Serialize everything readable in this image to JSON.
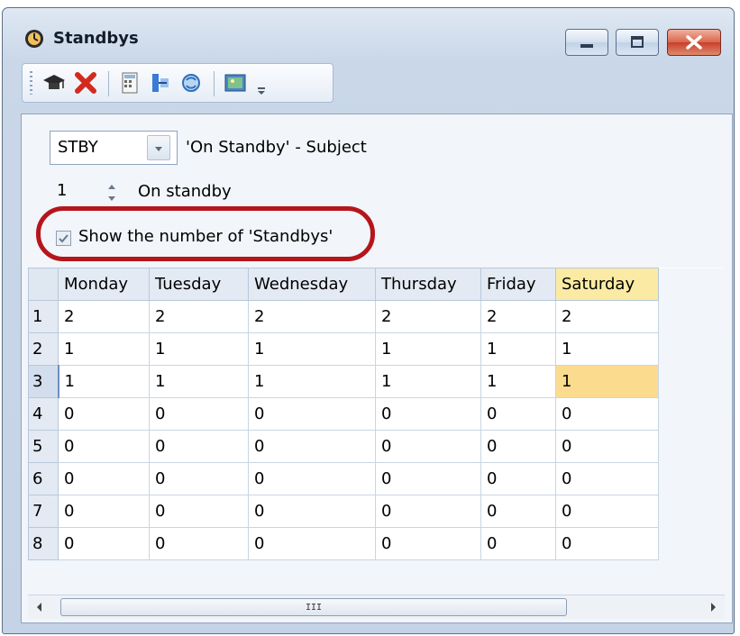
{
  "window": {
    "title": "Standbys"
  },
  "toolbar": {
    "icons": [
      "mortarboard-icon",
      "delete-icon",
      "calculator-icon",
      "transfer-icon",
      "refresh-icon",
      "picture-icon",
      "overflow-icon"
    ]
  },
  "subject": {
    "value": "STBY",
    "label": "'On Standby' - Subject"
  },
  "count": {
    "value": "1",
    "label": "On standby"
  },
  "show_number": {
    "checked": true,
    "label": "Show the number of 'Standbys'"
  },
  "grid": {
    "columns": [
      "Monday",
      "Tuesday",
      "Wednesday",
      "Thursday",
      "Friday",
      "Saturday"
    ],
    "rows": [
      {
        "num": "1",
        "cells": [
          "2",
          "2",
          "2",
          "2",
          "2",
          "2"
        ]
      },
      {
        "num": "2",
        "cells": [
          "1",
          "1",
          "1",
          "1",
          "1",
          "1"
        ]
      },
      {
        "num": "3",
        "cells": [
          "1",
          "1",
          "1",
          "1",
          "1",
          "1"
        ]
      },
      {
        "num": "4",
        "cells": [
          "0",
          "0",
          "0",
          "0",
          "0",
          "0"
        ]
      },
      {
        "num": "5",
        "cells": [
          "0",
          "0",
          "0",
          "0",
          "0",
          "0"
        ]
      },
      {
        "num": "6",
        "cells": [
          "0",
          "0",
          "0",
          "0",
          "0",
          "0"
        ]
      },
      {
        "num": "7",
        "cells": [
          "0",
          "0",
          "0",
          "0",
          "0",
          "0"
        ]
      },
      {
        "num": "8",
        "cells": [
          "0",
          "0",
          "0",
          "0",
          "0",
          "0"
        ]
      }
    ],
    "selected": {
      "row": 3,
      "column": "Saturday"
    }
  },
  "scrollbar": {
    "grip": "III"
  },
  "colors": {
    "highlight_ring": "#b5151b",
    "selection": "#fbdc8e",
    "column_header_selected": "#fbeaa3"
  }
}
